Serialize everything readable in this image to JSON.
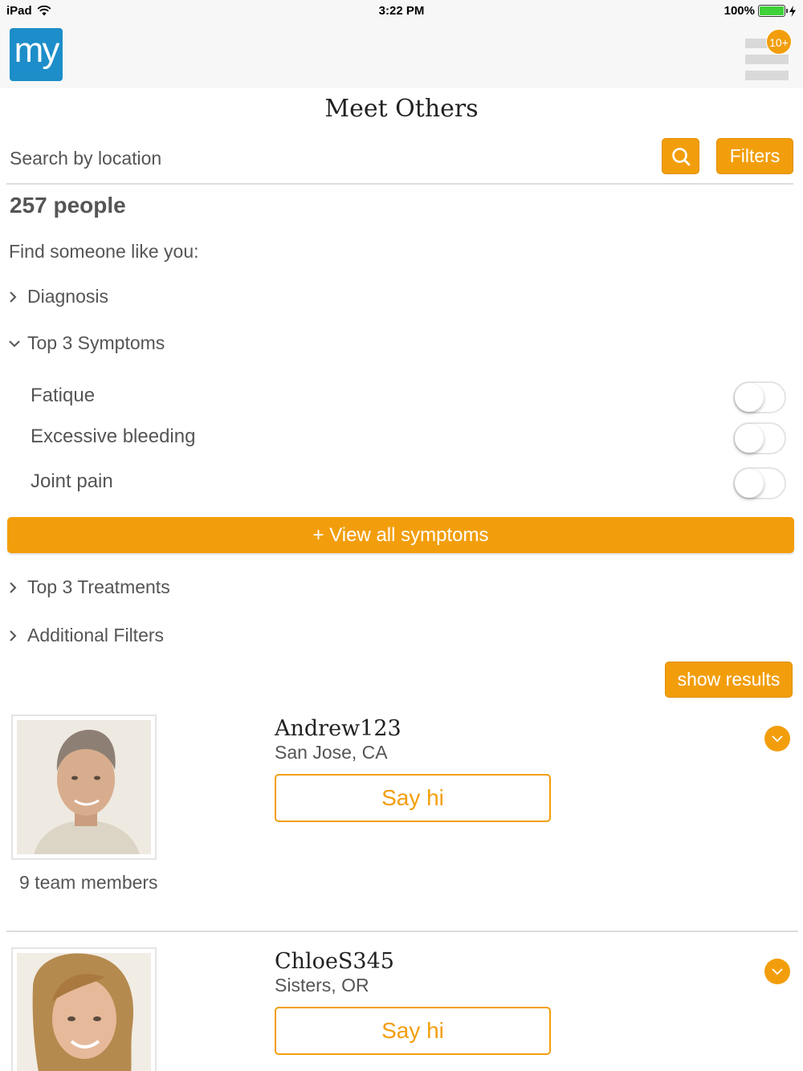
{
  "status_bar": {
    "device": "iPad",
    "time": "3:22 PM",
    "battery": "100%",
    "battery_level": 1.0,
    "wifi_icon": "wifi-icon",
    "charging_icon": "bolt-icon"
  },
  "header": {
    "logo_text": "my",
    "logo_color": "#1d8ec9",
    "menu_icon": "hamburger-menu-icon",
    "notification_badge": "10+"
  },
  "page": {
    "title": "Meet Others"
  },
  "search": {
    "placeholder": "Search by location",
    "icon": "search-icon",
    "filters_label": "Filters"
  },
  "results": {
    "people_count": "257 people",
    "find_label": "Find someone like you:"
  },
  "filters": {
    "diagnosis": {
      "label": "Diagnosis",
      "expanded": false
    },
    "symptoms": {
      "label": "Top 3 Symptoms",
      "expanded": true,
      "items": [
        {
          "label": "Fatique",
          "on": false
        },
        {
          "label": "Excessive bleeding",
          "on": false
        },
        {
          "label": "Joint pain",
          "on": false
        }
      ],
      "view_all_label": "+ View all symptoms"
    },
    "treatments": {
      "label": "Top 3 Treatments",
      "expanded": false
    },
    "additional": {
      "label": "Additional Filters",
      "expanded": false
    },
    "show_results_label": "show results"
  },
  "members": [
    {
      "name": "Andrew123",
      "location": "San Jose, CA",
      "say_hi_label": "Say hi",
      "team_count": "9 team members"
    },
    {
      "name": "ChloeS345",
      "location": "Sisters, OR",
      "say_hi_label": "Say hi"
    }
  ],
  "colors": {
    "accent": "#f29e0c",
    "brand": "#1d8ec9",
    "text": "#555555"
  }
}
